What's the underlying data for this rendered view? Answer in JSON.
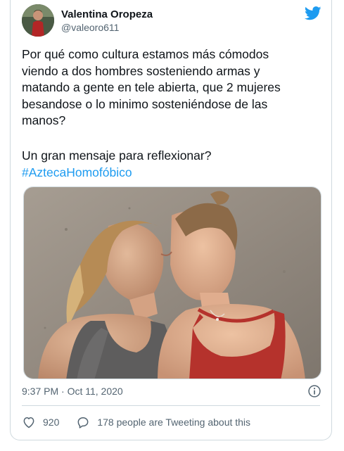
{
  "user": {
    "display_name": "Valentina Oropeza",
    "handle": "@valeoro611"
  },
  "tweet": {
    "text": "Por qué como cultura estamos más cómodos\nviendo a dos hombres sosteniendo armas y\nmatando a gente en tele abierta, que 2 mujeres\nbesandose o lo minimo sosteniéndose de las\nmanos?",
    "question": "Un gran mensaje para reflexionar?",
    "hashtag": "#AztecaHomofóbico",
    "timestamp": "9:37 PM · Oct 11, 2020"
  },
  "actions": {
    "likes": "920",
    "tweeting": "178 people are Tweeting about this"
  },
  "icons": {
    "brand": "twitter-bird-icon",
    "info": "info-icon",
    "like": "heart-icon",
    "reply": "speech-bubble-icon"
  },
  "colors": {
    "accent": "#1d9bf0",
    "text": "#0f1419",
    "secondary": "#536471",
    "border": "#cfd9de"
  }
}
